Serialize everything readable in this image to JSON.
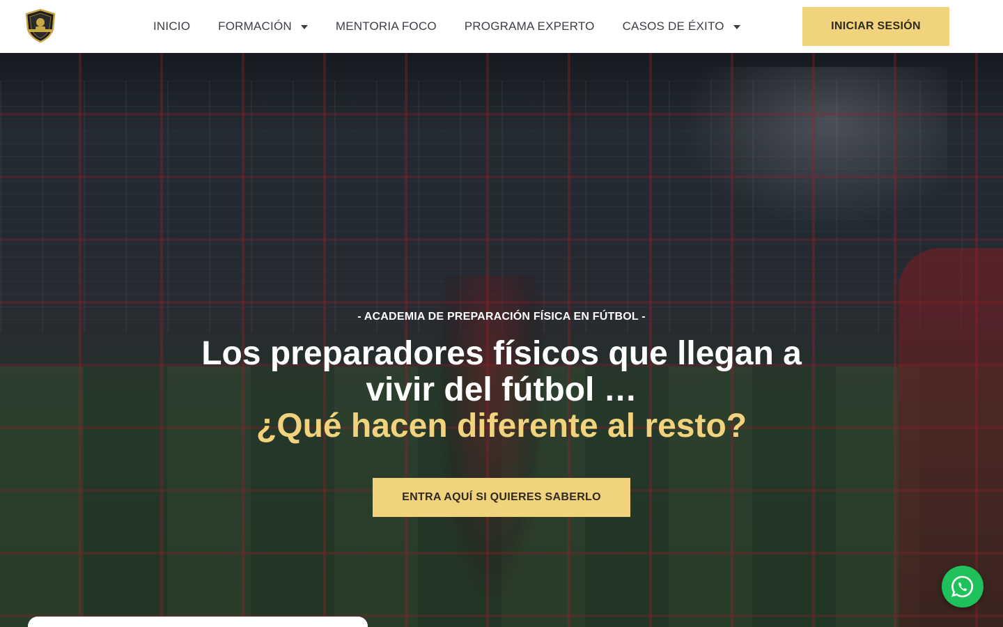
{
  "header": {
    "logo_icon": "academy-shield-logo",
    "nav": [
      {
        "label": "INICIO",
        "has_dropdown": false
      },
      {
        "label": "FORMACIÓN",
        "has_dropdown": true
      },
      {
        "label": "MENTORIA FOCO",
        "has_dropdown": false
      },
      {
        "label": "PROGRAMA EXPERTO",
        "has_dropdown": false
      },
      {
        "label": "CASOS DE ÉXITO",
        "has_dropdown": true
      }
    ],
    "login_label": "INICIAR SESIÓN"
  },
  "hero": {
    "eyebrow": "- ACADEMIA DE PREPARACIÓN FÍSICA EN FÚTBOL -",
    "title_line1": "Los preparadores físicos que llegan a",
    "title_line2": "vivir del fútbol …",
    "title_accent": "¿Qué hacen diferente al resto?",
    "cta_label": "ENTRA AQUÍ SI QUIERES SABERLO"
  },
  "floating": {
    "whatsapp_icon": "whatsapp-icon"
  },
  "colors": {
    "accent": "#f1d37e",
    "nav_text": "#3b3f45",
    "whatsapp": "#1fc15a"
  }
}
